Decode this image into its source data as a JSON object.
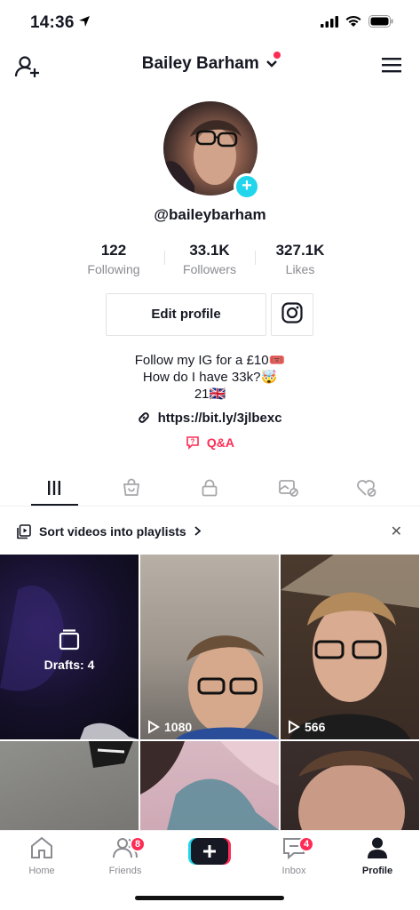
{
  "status": {
    "time": "14:36"
  },
  "header": {
    "title": "Bailey Barham"
  },
  "profile": {
    "username": "@baileybarham",
    "stats": [
      {
        "value": "122",
        "label": "Following"
      },
      {
        "value": "33.1K",
        "label": "Followers"
      },
      {
        "value": "327.1K",
        "label": "Likes"
      }
    ],
    "edit_label": "Edit profile",
    "bio": [
      "Follow my IG for a £10🎟️",
      "How do I have 33k?🤯",
      "21🇬🇧"
    ],
    "link": "https://bit.ly/3jlbexc",
    "qa": "Q&A"
  },
  "tabs": [
    "videos-grid-icon",
    "shop-bag-icon",
    "lock-icon",
    "tagged-icon",
    "liked-heart-icon"
  ],
  "playlist": {
    "label": "Sort videos into playlists"
  },
  "videos": [
    {
      "type": "drafts",
      "label": "Drafts: 4"
    },
    {
      "views": "1080"
    },
    {
      "views": "566"
    },
    {
      "views": ""
    },
    {
      "views": ""
    },
    {
      "views": ""
    }
  ],
  "nav": {
    "home": "Home",
    "friends": "Friends",
    "friends_badge": "8",
    "inbox": "Inbox",
    "inbox_badge": "4",
    "profile": "Profile"
  },
  "colors": {
    "accent": "#fe2c55",
    "cyan": "#20d5ec",
    "text": "#161823",
    "muted": "#8a8b91"
  }
}
